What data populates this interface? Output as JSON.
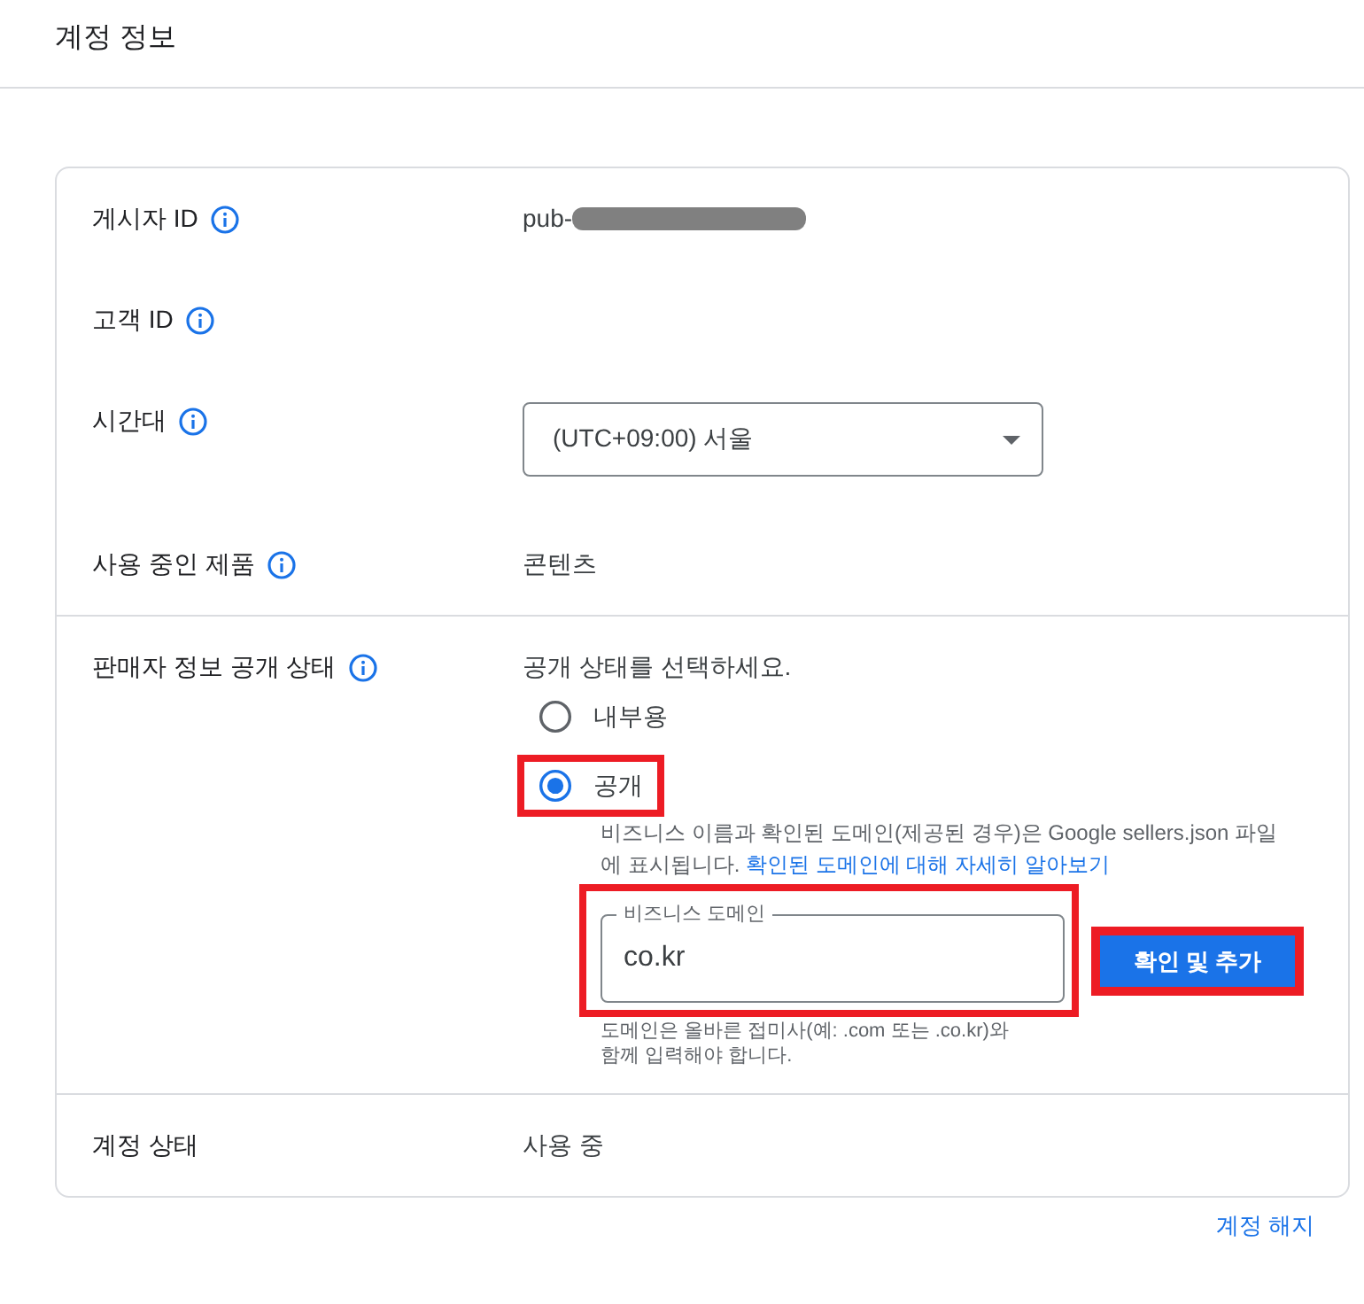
{
  "page": {
    "title": "계정 정보"
  },
  "sections": [
    {
      "rows": [
        {
          "kind": "text",
          "label": "게시자 ID",
          "info": true,
          "value": "pub-",
          "redacted": true
        },
        {
          "kind": "text",
          "label": "고객 ID",
          "info": true,
          "redacted": false
        },
        {
          "kind": "select",
          "label": "시간대",
          "info": true,
          "value": "(UTC+09:00) 서울"
        },
        {
          "kind": "text",
          "label": "사용 중인 제품",
          "info": true,
          "value": "콘텐츠",
          "redacted": false
        }
      ]
    },
    {
      "rows": [
        {
          "kind": "radio_group",
          "label": "판매자 정보 공개 상태",
          "info": true,
          "prompt": "공개 상태를 선택하세요.",
          "options": [
            {
              "label": "내부용",
              "selected": false,
              "highlighted": false
            },
            {
              "label": "공개",
              "selected": true,
              "highlighted": true,
              "description": "비즈니스 이름과 확인된 도메인(제공된 경우)은 Google sellers.json 파일에 표시됩니다.",
              "description_link": "확인된 도메인에 대해 자세히 알아보기",
              "domain_field": {
                "label": "비즈니스 도메인",
                "value": "co.kr",
                "helper": "도메인은 올바른 접미사(예: .com 또는 .co.kr)와 함께 입력해야 합니다.",
                "highlighted": true
              },
              "button": {
                "label": "확인 및 추가",
                "highlighted": true
              }
            }
          ]
        }
      ]
    },
    {
      "rows": [
        {
          "kind": "text",
          "label": "계정 상태",
          "info": false,
          "value": "사용 중",
          "redacted": false
        }
      ]
    }
  ],
  "footer_link": "계정 해지"
}
